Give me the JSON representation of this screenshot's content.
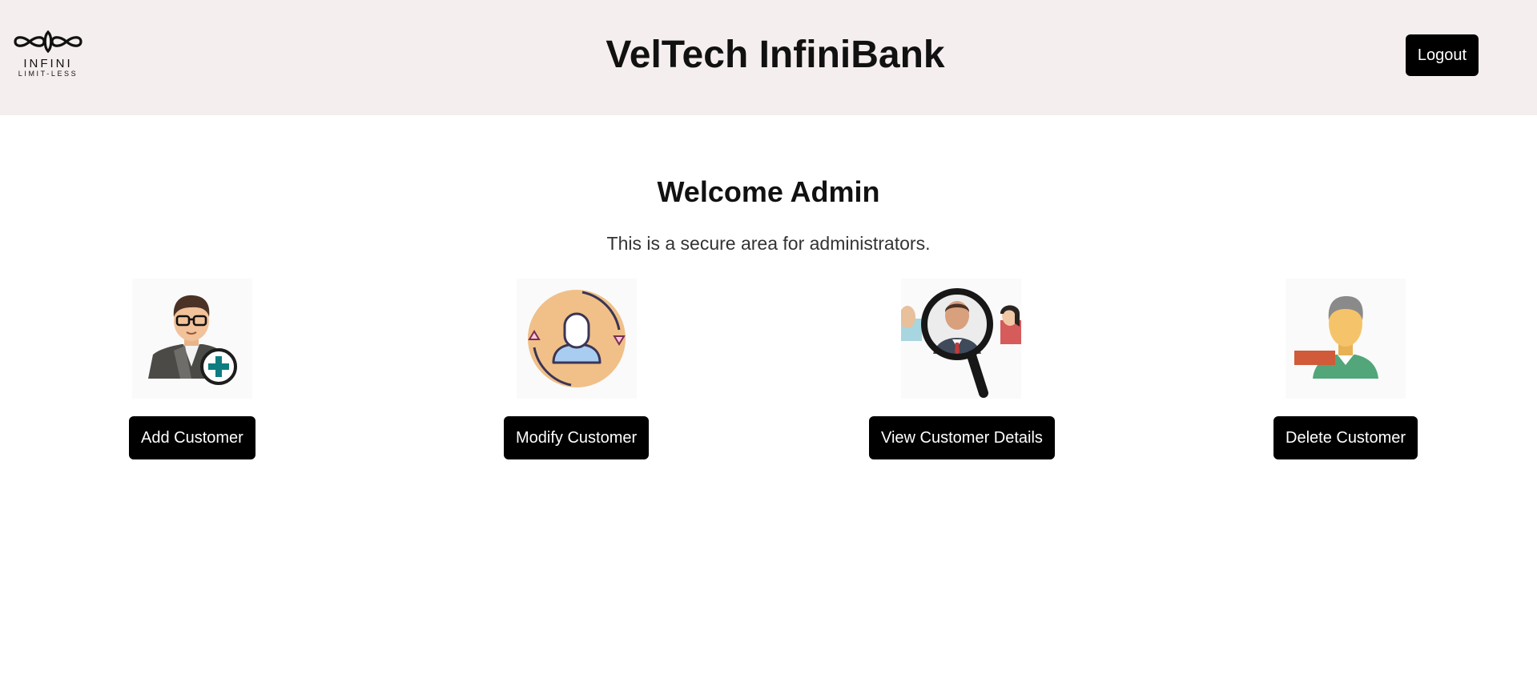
{
  "header": {
    "logo_word": "INFINI",
    "logo_tagline": "LIMIT-LESS",
    "title": "VelTech InfiniBank",
    "logout_label": "Logout"
  },
  "main": {
    "welcome": "Welcome Admin",
    "subtitle": "This is a secure area for administrators.",
    "actions": [
      {
        "label": "Add Customer",
        "icon": "add-customer-icon"
      },
      {
        "label": "Modify Customer",
        "icon": "modify-customer-icon"
      },
      {
        "label": "View Customer Details",
        "icon": "view-customer-details-icon"
      },
      {
        "label": "Delete Customer",
        "icon": "delete-customer-icon"
      }
    ]
  },
  "colors": {
    "header_bg": "#f5eeee",
    "button_bg": "#000000",
    "button_text": "#ffffff",
    "accent_teal": "#0e7d80",
    "accent_orange": "#f0c088",
    "accent_red": "#d05a3a",
    "accent_green": "#52a67a"
  }
}
